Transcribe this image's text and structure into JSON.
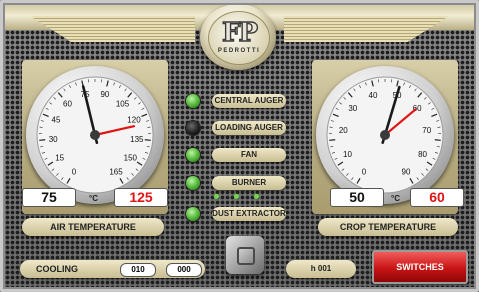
{
  "logo": {
    "mark": "FP",
    "brand": "PEDROTTI"
  },
  "air_gauge": {
    "ticks": [
      "0",
      "15",
      "30",
      "45",
      "60",
      "75",
      "90",
      "105",
      "120",
      "135",
      "150",
      "165"
    ],
    "actual": "75",
    "setpoint": "125",
    "unit": "°C",
    "label": "AIR TEMPERATURE",
    "needle_value": 75,
    "set_value": 125
  },
  "crop_gauge": {
    "ticks": [
      "0",
      "10",
      "20",
      "30",
      "40",
      "50",
      "60",
      "70",
      "80",
      "90"
    ],
    "actual": "50",
    "setpoint": "60",
    "unit": "°C",
    "label": "CROP TEMPERATURE",
    "needle_value": 50,
    "set_value": 60
  },
  "indicators": [
    {
      "label": "CENTRAL AUGER",
      "state": "on"
    },
    {
      "label": "LOADING AUGER",
      "state": "off"
    },
    {
      "label": "FAN",
      "state": "on"
    },
    {
      "label": "BURNER",
      "state": "on"
    },
    {
      "label": "DUST EXTRACTOR",
      "state": "on"
    }
  ],
  "cooling": {
    "label": "COOLING",
    "value_a": "010",
    "value_b": "000"
  },
  "hours": "h 001",
  "switches_label": "SWITCHES",
  "colors": {
    "setpoint_red": "#e01414",
    "led_green": "#4fb234",
    "panel_gold": "#c8bd92"
  }
}
